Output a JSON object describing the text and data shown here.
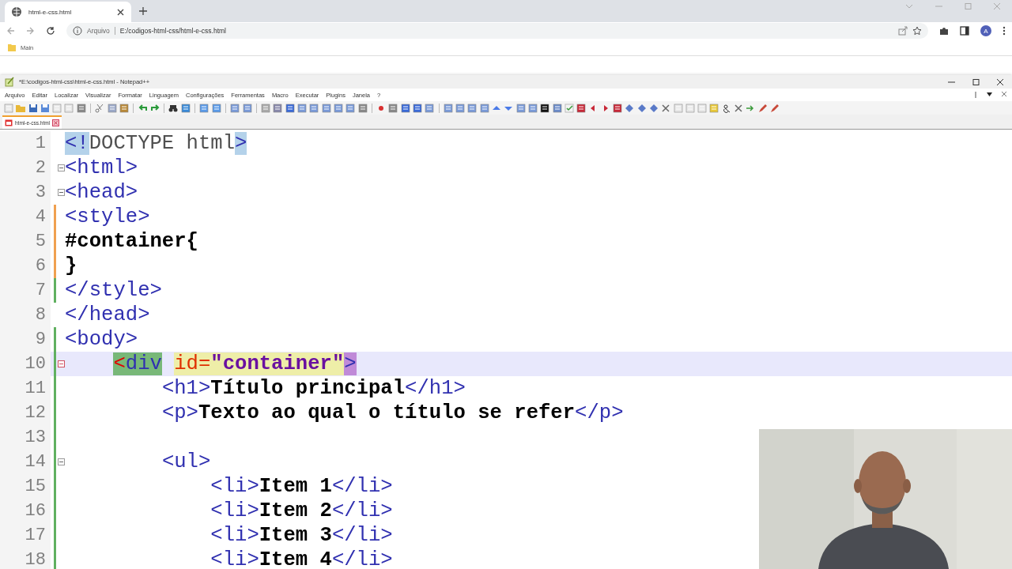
{
  "browser": {
    "tabs": [
      {
        "title": "html-e-css.html",
        "selected": true
      }
    ],
    "address": {
      "label": "Arquivo",
      "url": "E:/codigos-html-css/html-e-css.html"
    },
    "bookmarks": [
      {
        "label": "Main"
      }
    ],
    "profile": "A"
  },
  "editor": {
    "title": "*E:\\codigos-html-css\\html-e-css.html - Notepad++",
    "menu": [
      "Arquivo",
      "Editar",
      "Localizar",
      "Visualizar",
      "Formatar",
      "Linguagem",
      "Configurações",
      "Ferramentas",
      "Macro",
      "Executar",
      "Plugins",
      "Janela",
      "?"
    ],
    "tabs": [
      {
        "label": "html-e-css.html",
        "selected": true,
        "modified": true
      }
    ],
    "lines": [
      {
        "number": "1",
        "fold": false,
        "unsaved_change": false,
        "saved_change": false,
        "current": false,
        "tokens": [
          {
            "kind": "tag",
            "text": "<!",
            "color": "#b4d2ea"
          },
          {
            "kind": "doctype",
            "text": "DOCTYPE html"
          },
          {
            "kind": "tag",
            "text": ">",
            "color": "#b4d2ea"
          }
        ]
      },
      {
        "number": "2",
        "fold": true,
        "unsaved_change": false,
        "saved_change": false,
        "current": false,
        "tokens": [
          {
            "kind": "tag",
            "text": "<html>"
          }
        ]
      },
      {
        "number": "3",
        "fold": true,
        "unsaved_change": false,
        "saved_change": false,
        "current": false,
        "tokens": [
          {
            "kind": "tag",
            "text": "<head>"
          }
        ]
      },
      {
        "number": "4",
        "fold": false,
        "unsaved_change": true,
        "saved_change": false,
        "current": false,
        "tokens": [
          {
            "kind": "tag",
            "text": "<style>"
          }
        ]
      },
      {
        "number": "5",
        "fold": false,
        "unsaved_change": true,
        "saved_change": false,
        "current": false,
        "tokens": [
          {
            "kind": "text",
            "text": "#container{"
          }
        ]
      },
      {
        "number": "6",
        "fold": false,
        "unsaved_change": true,
        "saved_change": false,
        "current": false,
        "tokens": [
          {
            "kind": "text",
            "text": "}"
          }
        ]
      },
      {
        "number": "7",
        "fold": false,
        "unsaved_change": false,
        "saved_change": true,
        "current": false,
        "tokens": [
          {
            "kind": "tag",
            "text": "</style>"
          }
        ]
      },
      {
        "number": "8",
        "fold": false,
        "unsaved_change": false,
        "saved_change": false,
        "current": false,
        "tokens": [
          {
            "kind": "tag",
            "text": "</head>"
          }
        ]
      },
      {
        "number": "9",
        "fold": false,
        "unsaved_change": false,
        "saved_change": true,
        "current": false,
        "tokens": [
          {
            "kind": "tag",
            "text": "<body>"
          }
        ]
      },
      {
        "number": "10",
        "fold": true,
        "unsaved_change": false,
        "saved_change": true,
        "current": true,
        "tokens": [
          {
            "kind": "bracket",
            "text": "    <",
            "color": "#78b878"
          },
          {
            "kind": "tag",
            "text": "div",
            "color": "#78b878"
          },
          {
            "kind": "attr",
            "text": " id=",
            "color": "#eeeea8"
          },
          {
            "kind": "value",
            "text": "\"container\"",
            "color": "#eeeea8"
          },
          {
            "kind": "tag",
            "text": ">",
            "color": "#c08ad8"
          }
        ]
      },
      {
        "number": "11",
        "fold": false,
        "unsaved_change": false,
        "saved_change": true,
        "current": false,
        "tokens": [
          {
            "kind": "tag",
            "text": "        <h1>"
          },
          {
            "kind": "text",
            "text": "Título principal"
          },
          {
            "kind": "tag",
            "text": "</h1>"
          }
        ]
      },
      {
        "number": "12",
        "fold": false,
        "unsaved_change": false,
        "saved_change": true,
        "current": false,
        "tokens": [
          {
            "kind": "tag",
            "text": "        <p>"
          },
          {
            "kind": "text",
            "text": "Texto ao qual o título se refer"
          },
          {
            "kind": "tag",
            "text": "</p>"
          }
        ]
      },
      {
        "number": "13",
        "fold": false,
        "unsaved_change": false,
        "saved_change": true,
        "current": false
      },
      {
        "number": "14",
        "fold": true,
        "unsaved_change": false,
        "saved_change": true,
        "current": false,
        "tokens": [
          {
            "kind": "tag",
            "text": "        <ul>"
          }
        ]
      },
      {
        "number": "15",
        "fold": false,
        "unsaved_change": false,
        "saved_change": true,
        "current": false,
        "tokens": [
          {
            "kind": "tag",
            "text": "            <li>"
          },
          {
            "kind": "text",
            "text": "Item 1"
          },
          {
            "kind": "tag",
            "text": "</li>"
          }
        ]
      },
      {
        "number": "16",
        "fold": false,
        "unsaved_change": false,
        "saved_change": true,
        "current": false,
        "tokens": [
          {
            "kind": "tag",
            "text": "            <li>"
          },
          {
            "kind": "text",
            "text": "Item 2"
          },
          {
            "kind": "tag",
            "text": "</li>"
          }
        ]
      },
      {
        "number": "17",
        "fold": false,
        "unsaved_change": false,
        "saved_change": true,
        "current": false,
        "tokens": [
          {
            "kind": "tag",
            "text": "            <li>"
          },
          {
            "kind": "text",
            "text": "Item 3"
          },
          {
            "kind": "tag",
            "text": "</li>"
          }
        ]
      },
      {
        "number": "18",
        "fold": false,
        "unsaved_change": false,
        "saved_change": true,
        "current": false,
        "tokens": [
          {
            "kind": "tag",
            "text": "            <li>"
          },
          {
            "kind": "text",
            "text": "Item 4"
          },
          {
            "kind": "tag",
            "text": "</li>"
          }
        ]
      }
    ]
  }
}
